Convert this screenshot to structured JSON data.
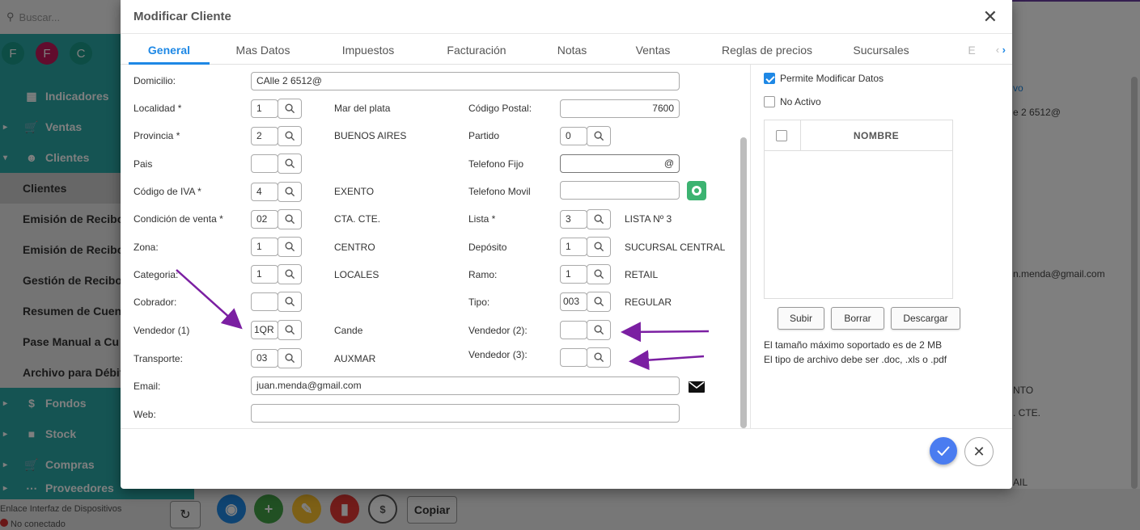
{
  "background": {
    "search_placeholder": "Buscar...",
    "avatars": [
      {
        "letter": "F",
        "color": "#1a9a8a"
      },
      {
        "letter": "F",
        "color": "#c2185b"
      },
      {
        "letter": "C",
        "color": "#1a9a8a"
      }
    ],
    "nav": {
      "indicadores": "Indicadores",
      "ventas": "Ventas",
      "clientes": "Clientes",
      "subitems": [
        "Clientes",
        "Emisión de Recibo",
        "Emisión de Recibo",
        "Gestión de Recibos",
        "Resumen de Cuent",
        "Pase Manual a Cu",
        "Archivo para Débit"
      ],
      "fondos": "Fondos",
      "stock": "Stock",
      "compras": "Compras",
      "proveedores": "Proveedores"
    },
    "footer": {
      "line1": "Enlace Interfaz de Dispositivos",
      "line2": "No conectado"
    },
    "right_texts": [
      "vo",
      "e 2 6512@",
      "n.menda@gmail.com",
      "NTO",
      ". CTE.",
      "AIL"
    ],
    "copy_label": "Copiar"
  },
  "modal": {
    "title": "Modificar Cliente",
    "tabs": [
      "General",
      "Mas Datos",
      "Impuestos",
      "Facturación",
      "Notas",
      "Ventas",
      "Reglas de precios",
      "Sucursales",
      "E"
    ],
    "active_tab": "General",
    "left": {
      "domicilio": {
        "label": "Domicilio:",
        "value": "CAlle 2 6512@"
      },
      "localidad": {
        "label": "Localidad *",
        "code": "1",
        "desc": "Mar del plata"
      },
      "provincia": {
        "label": "Provincia *",
        "code": "2",
        "desc": "BUENOS AIRES"
      },
      "pais": {
        "label": "Pais",
        "code": "",
        "desc": ""
      },
      "codigo_iva": {
        "label": "Código de IVA *",
        "code": "4",
        "desc": "EXENTO"
      },
      "condicion_venta": {
        "label": "Condición de venta *",
        "code": "02",
        "desc": "CTA. CTE."
      },
      "zona": {
        "label": "Zona:",
        "code": "1",
        "desc": "CENTRO"
      },
      "categoria": {
        "label": "Categoria:",
        "code": "1",
        "desc": "LOCALES"
      },
      "cobrador": {
        "label": "Cobrador:",
        "code": "",
        "desc": ""
      },
      "vendedor1": {
        "label": "Vendedor (1)",
        "code": "1QR",
        "desc": "Cande"
      },
      "transporte": {
        "label": "Transporte:",
        "code": "03",
        "desc": "AUXMAR"
      },
      "email": {
        "label": "Email:",
        "value": "juan.menda@gmail.com"
      },
      "web": {
        "label": "Web:",
        "value": ""
      }
    },
    "middle": {
      "codigo_postal": {
        "label": "Código Postal:",
        "value": "7600"
      },
      "partido": {
        "label": "Partido",
        "code": "0"
      },
      "telefono_fijo": {
        "label": "Telefono Fijo",
        "value": "@"
      },
      "telefono_movil": {
        "label": "Telefono Movil",
        "value": ""
      },
      "lista": {
        "label": "Lista *",
        "code": "3",
        "desc": "LISTA Nº 3"
      },
      "deposito": {
        "label": "Depósito",
        "code": "1",
        "desc": "SUCURSAL CENTRAL"
      },
      "ramo": {
        "label": "Ramo:",
        "code": "1",
        "desc": "RETAIL"
      },
      "tipo": {
        "label": "Tipo:",
        "code": "003",
        "desc": "REGULAR"
      },
      "vendedor2": {
        "label": "Vendedor (2):",
        "code": ""
      },
      "vendedor3": {
        "label": "Vendedor (3):",
        "code": ""
      }
    },
    "right": {
      "permite_modificar": {
        "label": "Permite Modificar Datos",
        "checked": true
      },
      "no_activo": {
        "label": "No Activo",
        "checked": false
      },
      "table_header": "NOMBRE",
      "btn_subir": "Subir",
      "btn_borrar": "Borrar",
      "btn_descargar": "Descargar",
      "info1": "El tamaño máximo soportado es de 2 MB",
      "info2": "El tipo de archivo debe ser .doc, .xls o .pdf"
    },
    "accent_color": "#1e88e5",
    "annotation_arrow_color": "#7b1fa2"
  }
}
